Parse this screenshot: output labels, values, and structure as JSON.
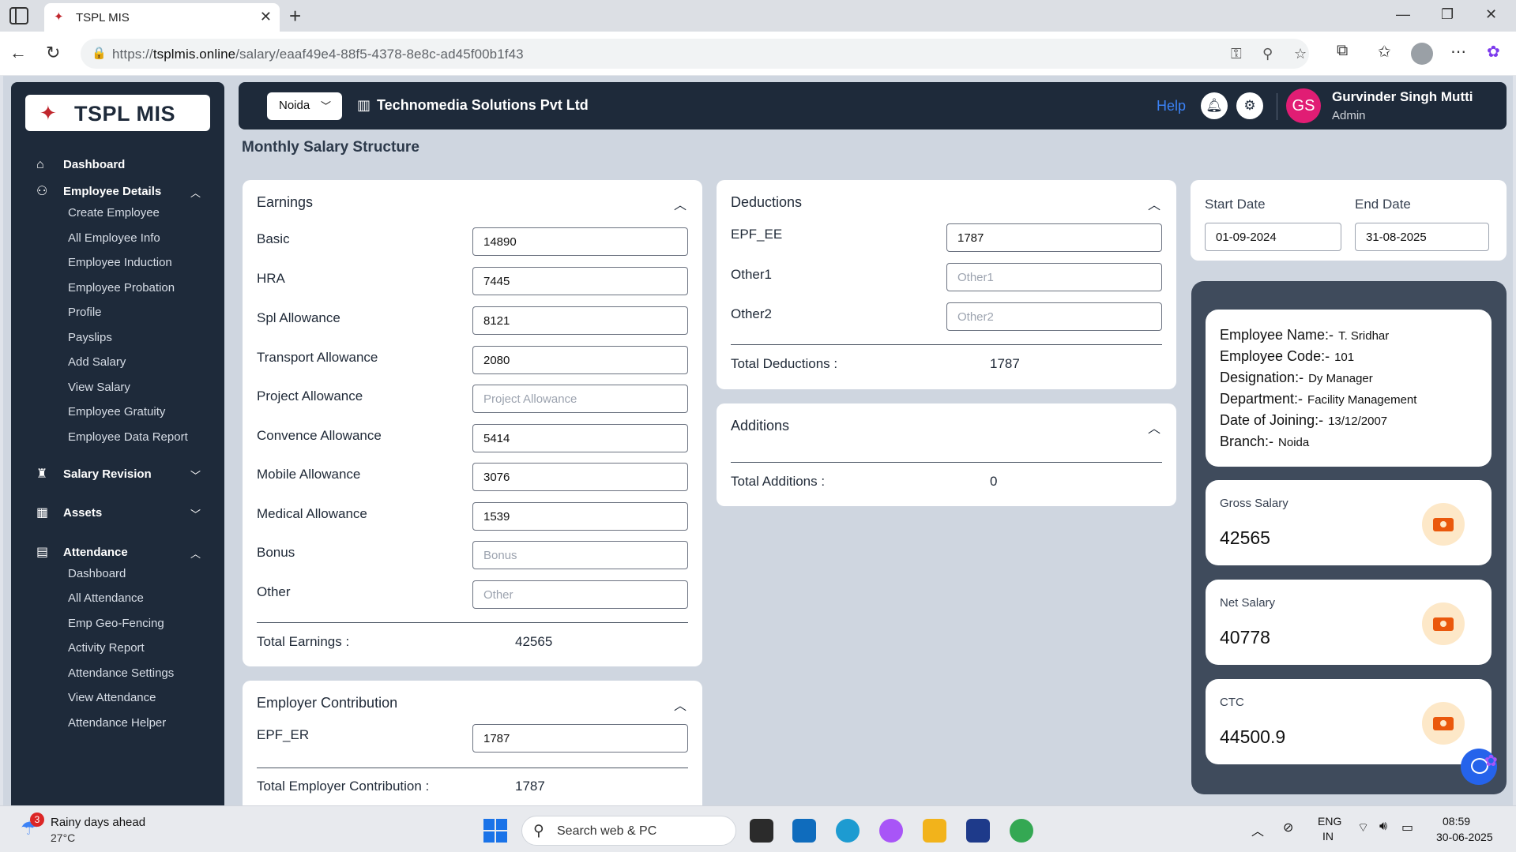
{
  "browser": {
    "tab_title": "TSPL MIS",
    "url_prefix": "https://",
    "url_host": "tsplmis.online",
    "url_path": "/salary/eaaf49e4-88f5-4378-8e8c-ad45f00b1f43"
  },
  "sidebar": {
    "logo": "TSPL MIS",
    "dashboard": "Dashboard",
    "employee_details": {
      "label": "Employee Details",
      "items": [
        "Create Employee",
        "All Employee Info",
        "Employee Induction",
        "Employee Probation",
        "Profile",
        "Payslips",
        "Add Salary",
        "View Salary",
        "Employee Gratuity",
        "Employee Data Report"
      ]
    },
    "salary_revision": "Salary Revision",
    "assets": "Assets",
    "attendance": {
      "label": "Attendance",
      "items": [
        "Dashboard",
        "All Attendance",
        "Emp Geo-Fencing",
        "Activity Report",
        "Attendance Settings",
        "View Attendance",
        "Attendance Helper"
      ]
    }
  },
  "topbar": {
    "branch": "Noida",
    "company": "Technomedia Solutions Pvt Ltd",
    "help": "Help",
    "user_initials": "GS",
    "user_name": "Gurvinder Singh Mutti",
    "user_role": "Admin"
  },
  "page_title": "Monthly Salary Structure",
  "earnings": {
    "title": "Earnings",
    "fields": [
      {
        "label": "Basic",
        "value": "14890",
        "placeholder": "Basic"
      },
      {
        "label": "HRA",
        "value": "7445",
        "placeholder": "HRA"
      },
      {
        "label": "Spl Allowance",
        "value": "8121",
        "placeholder": "Spl Allowance"
      },
      {
        "label": "Transport Allowance",
        "value": "2080",
        "placeholder": "Transport Allowance"
      },
      {
        "label": "Project Allowance",
        "value": "",
        "placeholder": "Project Allowance"
      },
      {
        "label": "Convence Allowance",
        "value": "5414",
        "placeholder": "Convence Allowance"
      },
      {
        "label": "Mobile Allowance",
        "value": "3076",
        "placeholder": "Mobile Allowance"
      },
      {
        "label": "Medical Allowance",
        "value": "1539",
        "placeholder": "Medical Allowance"
      },
      {
        "label": "Bonus",
        "value": "",
        "placeholder": "Bonus"
      },
      {
        "label": "Other",
        "value": "",
        "placeholder": "Other"
      }
    ],
    "total_label": "Total Earnings :",
    "total_value": "42565"
  },
  "employer_contribution": {
    "title": "Employer Contribution",
    "fields": [
      {
        "label": "EPF_ER",
        "value": "1787",
        "placeholder": "EPF_ER"
      }
    ],
    "total_label": "Total Employer Contribution :",
    "total_value": "1787"
  },
  "deductions": {
    "title": "Deductions",
    "fields": [
      {
        "label": "EPF_EE",
        "value": "1787",
        "placeholder": "EPF_EE"
      },
      {
        "label": "Other1",
        "value": "",
        "placeholder": "Other1"
      },
      {
        "label": "Other2",
        "value": "",
        "placeholder": "Other2"
      }
    ],
    "total_label": "Total Deductions :",
    "total_value": "1787"
  },
  "additions": {
    "title": "Additions",
    "total_label": "Total Additions :",
    "total_value": "0"
  },
  "dates": {
    "start_label": "Start Date",
    "start_value": "01-09-2024",
    "end_label": "End Date",
    "end_value": "31-08-2025"
  },
  "employee": {
    "name_label": "Employee Name:-",
    "name": "T. Sridhar",
    "code_label": "Employee Code:-",
    "code": "101",
    "designation_label": "Designation:-",
    "designation": "Dy Manager",
    "department_label": "Department:-",
    "department": "Facility Management",
    "doj_label": "Date of Joining:-",
    "doj": "13/12/2007",
    "branch_label": "Branch:-",
    "branch": "Noida"
  },
  "stats": {
    "gross_label": "Gross Salary",
    "gross": "42565",
    "net_label": "Net Salary",
    "net": "40778",
    "ctc_label": "CTC",
    "ctc": "44500.9"
  },
  "taskbar": {
    "weather_badge": "3",
    "weather_title": "Rainy days ahead",
    "weather_temp": "27°C",
    "search": "Search web & PC",
    "lang1": "ENG",
    "lang2": "IN",
    "time": "08:59",
    "date": "30-06-2025"
  },
  "colors": {
    "sidebar_bg": "#1e2a3a",
    "accent": "#3b82f6",
    "avatar": "#e11d74",
    "stat_icon": "#ea580c"
  }
}
